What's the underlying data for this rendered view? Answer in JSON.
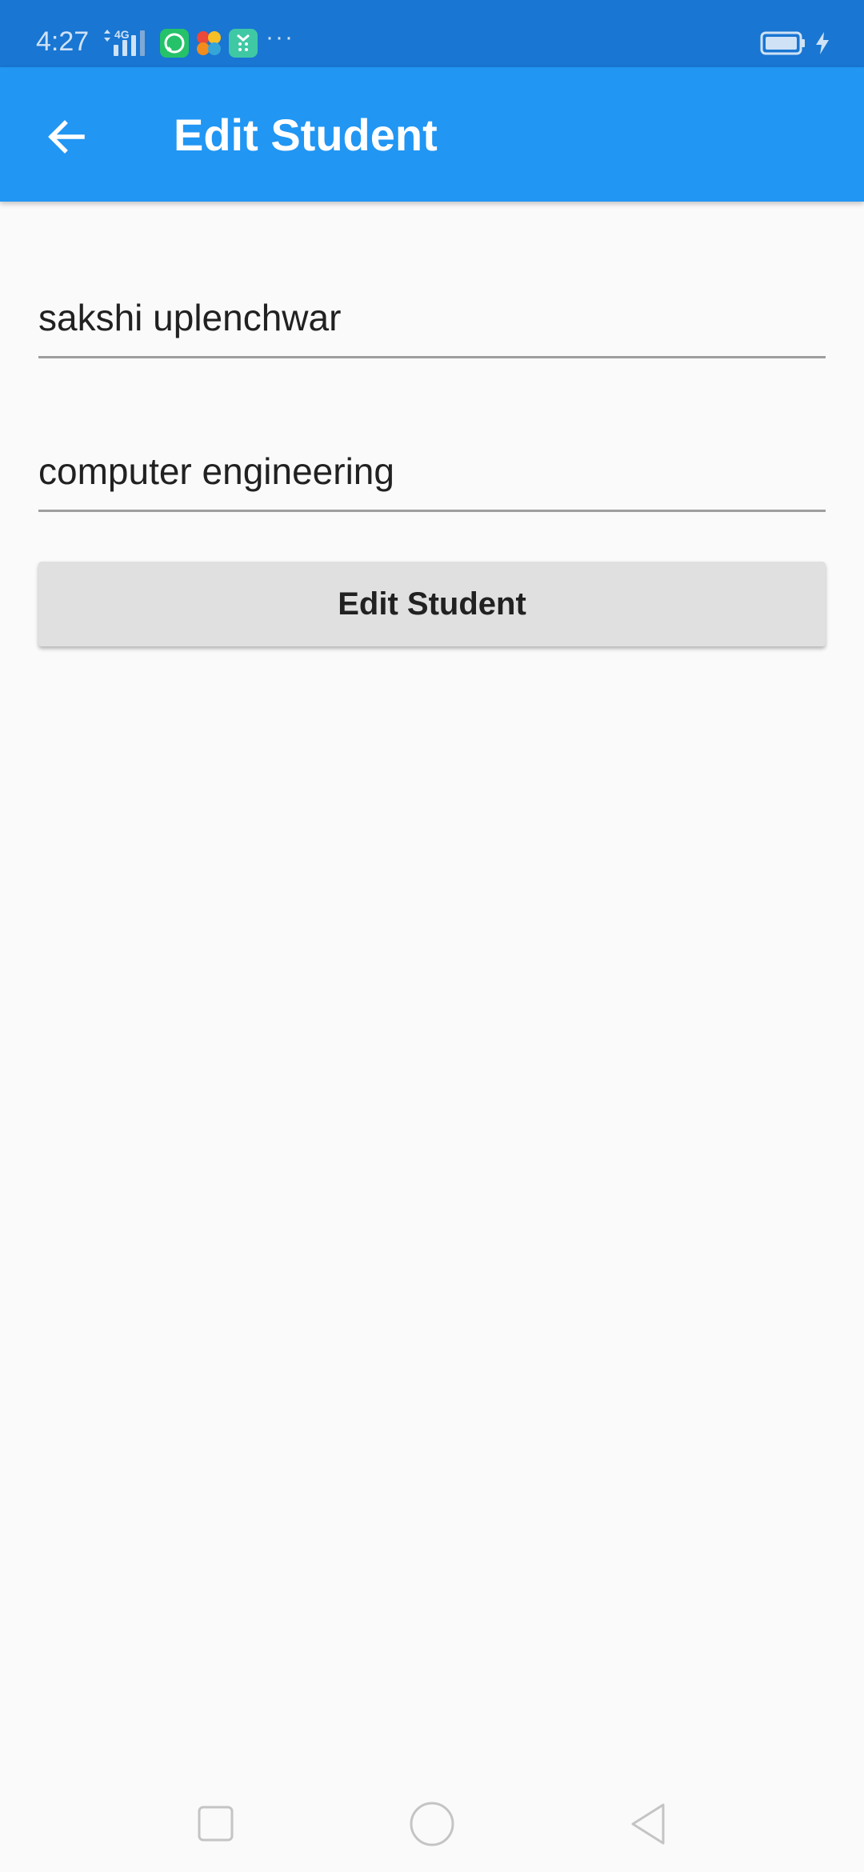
{
  "status_bar": {
    "time": "4:27",
    "network_label": "4G",
    "more": "···",
    "icons": [
      "signal-icon",
      "whatsapp-icon",
      "photos-icon",
      "calendar-icon",
      "battery-icon",
      "charging-icon"
    ]
  },
  "app_bar": {
    "title": "Edit Student",
    "back_icon": "arrow-back-icon",
    "color": "#2196f3",
    "status_color": "#1976d2"
  },
  "form": {
    "name_value": "sakshi uplenchwar",
    "department_value": "computer engineering",
    "submit_label": "Edit Student"
  },
  "nav_bar": {
    "icons": [
      "recents-icon",
      "home-icon",
      "back-triangle-icon"
    ]
  }
}
